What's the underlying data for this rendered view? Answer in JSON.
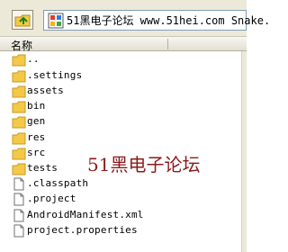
{
  "toolbar": {
    "address": "51黑电子论坛 www.51hei.com Snake.",
    "up_icon": "folder-up-icon",
    "address_icon": "workspace-icon"
  },
  "list": {
    "column_name": "名称",
    "items": [
      {
        "name": "..",
        "type": "folder"
      },
      {
        "name": ".settings",
        "type": "folder"
      },
      {
        "name": "assets",
        "type": "folder"
      },
      {
        "name": "bin",
        "type": "folder"
      },
      {
        "name": "gen",
        "type": "folder"
      },
      {
        "name": "res",
        "type": "folder"
      },
      {
        "name": "src",
        "type": "folder"
      },
      {
        "name": "tests",
        "type": "folder"
      },
      {
        "name": ".classpath",
        "type": "file"
      },
      {
        "name": ".project",
        "type": "file"
      },
      {
        "name": "AndroidManifest.xml",
        "type": "file"
      },
      {
        "name": "project.properties",
        "type": "file"
      }
    ]
  },
  "watermark": "51黑电子论坛",
  "colors": {
    "folder": "#f3c947",
    "folder_dark": "#c79a21",
    "watermark": "#8b1a1a"
  }
}
